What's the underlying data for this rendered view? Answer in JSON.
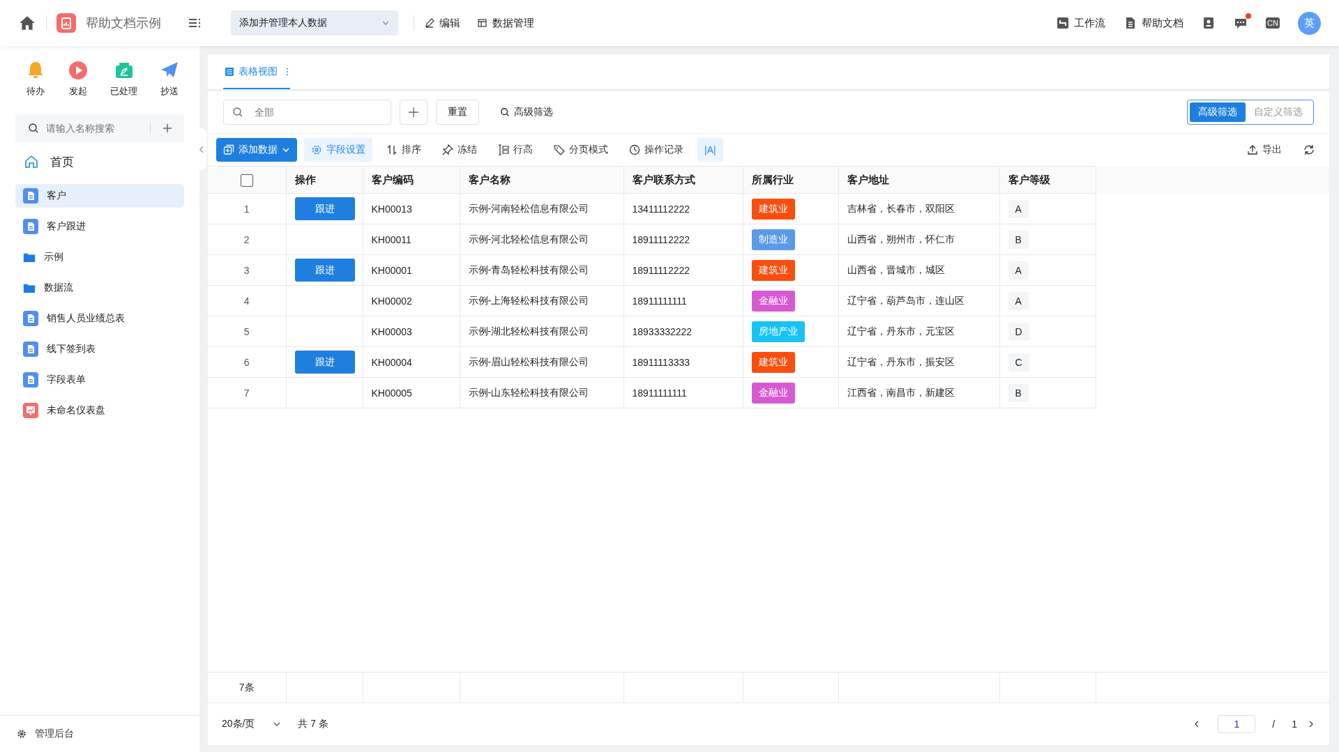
{
  "topbar": {
    "app_name": "帮助文档示例",
    "view_select": "添加并管理本人数据",
    "actions": [
      "编辑",
      "数据管理"
    ],
    "right_links": [
      "工作流",
      "帮助文档"
    ],
    "has_unread": true,
    "lang": "CN",
    "avatar": "英"
  },
  "sidebar": {
    "quick": [
      "待办",
      "发起",
      "已处理",
      "抄送"
    ],
    "search": {
      "placeholder": "请输入名称搜索"
    },
    "home": "首页",
    "items": [
      {
        "label": "客户",
        "kind": "form",
        "selected": true
      },
      {
        "label": "客户跟进",
        "kind": "form",
        "selected": false
      },
      {
        "label": "示例",
        "kind": "folder",
        "selected": false
      },
      {
        "label": "数据流",
        "kind": "folder",
        "selected": false
      },
      {
        "label": "销售人员业绩总表",
        "kind": "form",
        "selected": false
      },
      {
        "label": "线下签到表",
        "kind": "form",
        "selected": false
      },
      {
        "label": "字段表单",
        "kind": "form",
        "selected": false
      },
      {
        "label": "未命名仪表盘",
        "kind": "dashboard",
        "selected": false
      }
    ],
    "footer": "管理后台"
  },
  "tabs": [
    {
      "label": "表格视图",
      "selected": true
    }
  ],
  "filter": {
    "placeholder": "全部",
    "reset": "重置",
    "advanced": "高级筛选",
    "modes": [
      {
        "label": "高级筛选",
        "selected": true
      },
      {
        "label": "自定义筛选",
        "selected": false
      }
    ]
  },
  "toolbar": {
    "add": "添加数据",
    "items": [
      {
        "label": "字段设置",
        "active": true
      },
      {
        "label": "排序",
        "active": false
      },
      {
        "label": "冻结",
        "active": false
      },
      {
        "label": "行高",
        "active": false
      },
      {
        "label": "分页模式",
        "active": false
      },
      {
        "label": "操作记录",
        "active": false
      },
      {
        "label": "|A|",
        "active": true
      }
    ],
    "export": "导出"
  },
  "table": {
    "select_all_checked": false,
    "columns": [
      "操作",
      "客户编码",
      "客户名称",
      "客户联系方式",
      "所属行业",
      "客户地址",
      "客户等级"
    ],
    "rows": [
      {
        "no": "1",
        "action": "跟进",
        "code": "KH00013",
        "name": "示例-河南轻松信息有限公司",
        "phone": "13411112222",
        "industry": "建筑业",
        "color": "#fa4e0f",
        "address": "吉林省，长春市，双阳区",
        "grade": "A"
      },
      {
        "no": "2",
        "code": "KH00011",
        "name": "示例-河北轻松信息有限公司",
        "phone": "18911112222",
        "industry": "制造业",
        "color": "#5b9ae6",
        "address": "山西省，朔州市，怀仁市",
        "grade": "B"
      },
      {
        "no": "3",
        "action": "跟进",
        "code": "KH00001",
        "name": "示例-青岛轻松科技有限公司",
        "phone": "18911112222",
        "industry": "建筑业",
        "color": "#fa4e0f",
        "address": "山西省，晋城市，城区",
        "grade": "A"
      },
      {
        "no": "4",
        "code": "KH00002",
        "name": "示例-上海轻松科技有限公司",
        "phone": "18911111111",
        "industry": "金融业",
        "color": "#d759d2",
        "address": "辽宁省，葫芦岛市，连山区",
        "grade": "A"
      },
      {
        "no": "5",
        "code": "KH00003",
        "name": "示例-湖北轻松科技有限公司",
        "phone": "18933332222",
        "industry": "房地产业",
        "color": "#17c3f5",
        "address": "辽宁省，丹东市，元宝区",
        "grade": "D"
      },
      {
        "no": "6",
        "action": "跟进",
        "code": "KH00004",
        "name": "示例-眉山轻松科技有限公司",
        "phone": "18911113333",
        "industry": "建筑业",
        "color": "#fa4e0f",
        "address": "辽宁省，丹东市，振安区",
        "grade": "C"
      },
      {
        "no": "7",
        "code": "KH00005",
        "name": "示例-山东轻松科技有限公司",
        "phone": "18911111111",
        "industry": "金融业",
        "color": "#d759d2",
        "address": "江西省，南昌市，新建区",
        "grade": "B"
      }
    ],
    "summary": "7条"
  },
  "pagination": {
    "page_size": "20条/页",
    "total": "共 7 条",
    "page": "1",
    "separator": "/",
    "pages": "1"
  }
}
